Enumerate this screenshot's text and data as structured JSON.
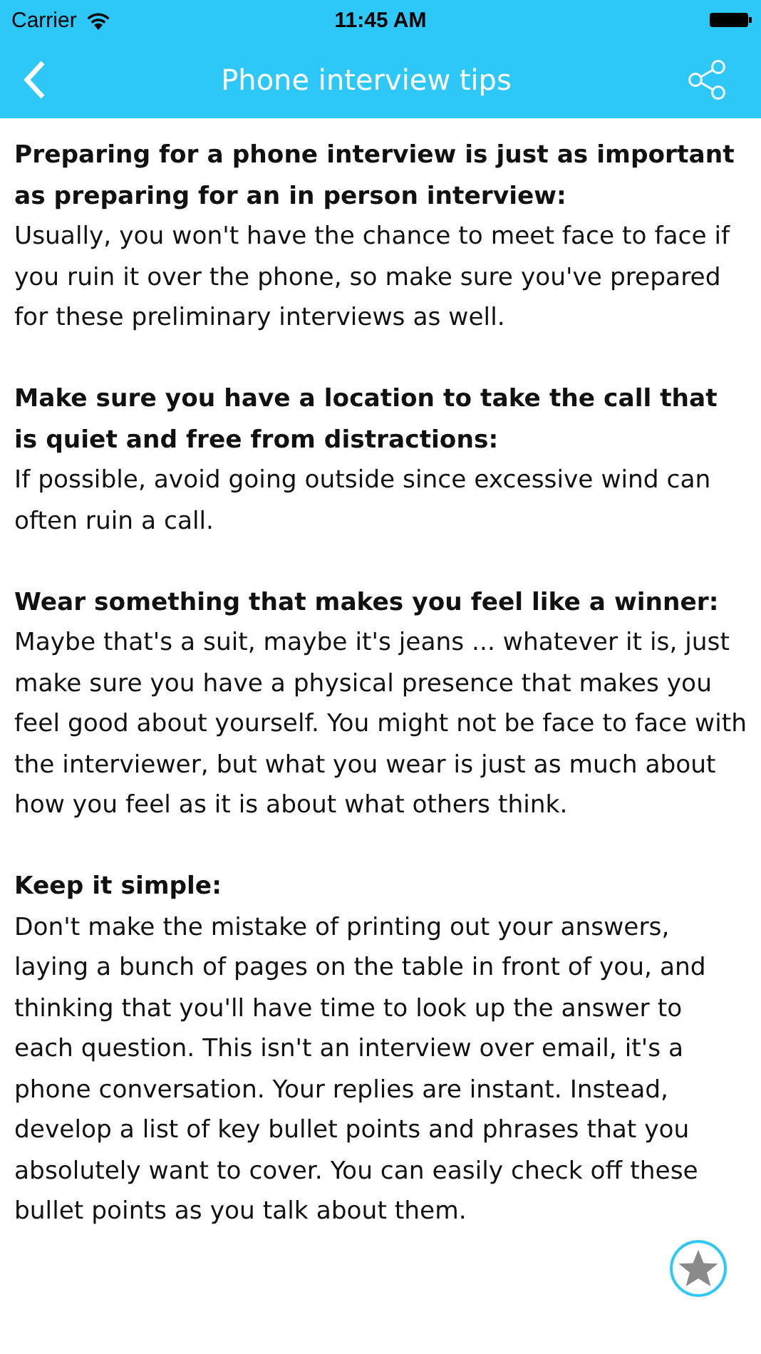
{
  "status_bar": {
    "carrier": "Carrier",
    "time": "11:45 AM"
  },
  "nav_bar": {
    "title": "Phone interview tips"
  },
  "sections": [
    {
      "heading": "Preparing for a phone interview is just as important as preparing for an in person interview:",
      "body": "Usually, you won't have the chance to meet face to face if you ruin it over the phone, so make sure you've prepared for these preliminary interviews as well."
    },
    {
      "heading": "Make sure you have a location to take the call that is quiet and free from distractions:",
      "body": "If possible, avoid going outside since excessive wind can often ruin a call."
    },
    {
      "heading": "Wear something that makes you feel like a winner:",
      "body": "Maybe that's a suit, maybe it's jeans ... whatever it is, just make sure you have a physical presence that makes you feel good about yourself. You might not be face to face with the interviewer, but what you wear is just as much about how you feel as it is about what others think."
    },
    {
      "heading": "Keep it simple:",
      "body": "Don't make the mistake of printing out your answers, laying a bunch of pages on the table in front of you, and thinking that you'll have time to look up the answer to each question. This isn't an interview over email, it's a phone conversation. Your replies are instant. Instead, develop a list of key bullet points and phrases that you absolutely want to cover. You can easily check off these bullet points as you talk about them."
    }
  ]
}
